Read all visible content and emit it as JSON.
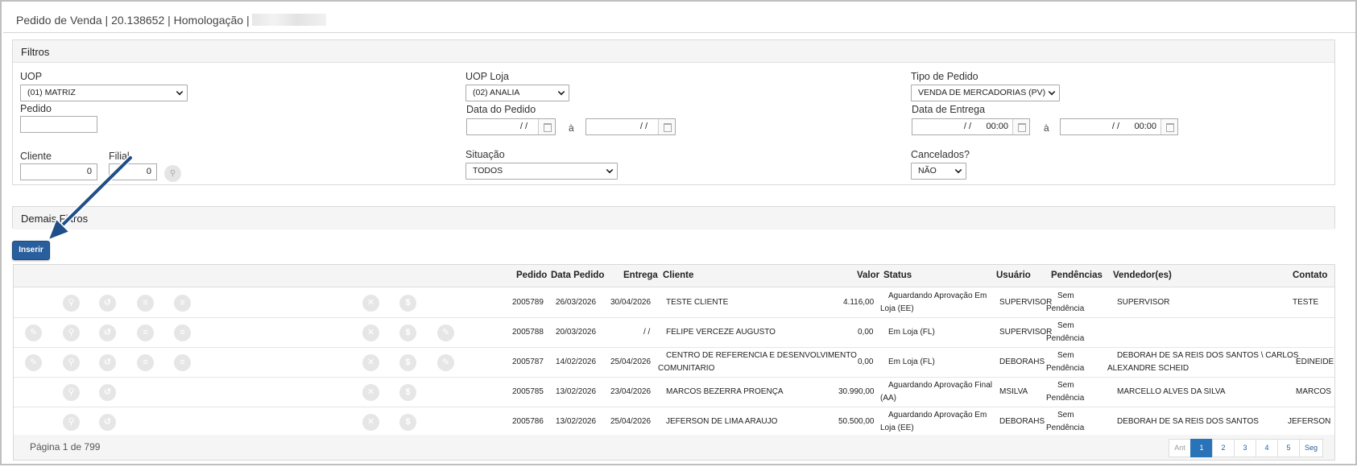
{
  "header": {
    "title": "Pedido de Venda | 20.138652 | Homologação | ",
    "masked_suffix": "_"
  },
  "filters": {
    "heading": "Filtros",
    "uop": {
      "label": "UOP",
      "value": "(01) MATRIZ"
    },
    "uop_loja": {
      "label": "UOP Loja",
      "value": "(02) ANALIA"
    },
    "tipo_pedido": {
      "label": "Tipo de Pedido",
      "value": "VENDA DE MERCADORIAS (PV)"
    },
    "pedido": {
      "label": "Pedido",
      "value": ""
    },
    "data_pedido": {
      "label": "Data do Pedido",
      "from": "/ /",
      "to": "/ /",
      "sep": "à"
    },
    "data_entrega": {
      "label": "Data de Entrega",
      "from": "/ /",
      "from_time": "00:00",
      "to": "/ /",
      "to_time": "00:00",
      "sep": "à"
    },
    "cliente": {
      "label": "Cliente",
      "value": "0"
    },
    "filial": {
      "label": "Filial",
      "value": "0"
    },
    "situacao": {
      "label": "Situação",
      "value": "TODOS"
    },
    "cancelados": {
      "label": "Cancelados?",
      "value": "NÃO"
    }
  },
  "demais_filtros": {
    "heading": "Demais Filtros"
  },
  "actions": {
    "inserir_label": "Inserir"
  },
  "table": {
    "columns": {
      "pedido": "Pedido",
      "data": "Data Pedido",
      "entrega": "Entrega",
      "cliente": "Cliente",
      "valor": "Valor",
      "status": "Status",
      "usuario": "Usuário",
      "pendencias": "Pendências",
      "vendedor": "Vendedor(es)",
      "contato": "Contato"
    },
    "rows": [
      {
        "pedido": "2005789",
        "data": "26/03/2026",
        "entrega": "30/04/2026",
        "cliente1": "TESTE CLIENTE",
        "cliente2": "",
        "valor": "4.116,00",
        "status1": "Aguardando Aprovação Em",
        "status2": "Loja (EE)",
        "usuario": "SUPERVISOR",
        "pend1": "Sem",
        "pend2": "Pendência",
        "vend1": "SUPERVISOR",
        "vend2": "",
        "contato": "TESTE"
      },
      {
        "pedido": "2005788",
        "data": "20/03/2026",
        "entrega": "/ /",
        "cliente1": "FELIPE VERCEZE AUGUSTO",
        "cliente2": "",
        "valor": "0,00",
        "status1": "Em Loja (FL)",
        "status2": "",
        "usuario": "SUPERVISOR",
        "pend1": "Sem",
        "pend2": "Pendência",
        "vend1": "",
        "vend2": "",
        "contato": ""
      },
      {
        "pedido": "2005787",
        "data": "14/02/2026",
        "entrega": "25/04/2026",
        "cliente1": "CENTRO DE REFERENCIA E DESENVOLVIMENTO",
        "cliente2": "COMUNITARIO",
        "valor": "0,00",
        "status1": "Em Loja (FL)",
        "status2": "",
        "usuario": "DEBORAHS",
        "pend1": "Sem",
        "pend2": "Pendência",
        "vend1": "DEBORAH DE SA REIS DOS SANTOS \\ CARLOS",
        "vend2": "ALEXANDRE SCHEID",
        "contato": "EDINEIDE"
      },
      {
        "pedido": "2005785",
        "data": "13/02/2026",
        "entrega": "23/04/2026",
        "cliente1": "MARCOS BEZERRA PROENÇA",
        "cliente2": "",
        "valor": "30.990,00",
        "status1": "Aguardando Aprovação Final",
        "status2": "(AA)",
        "usuario": "MSILVA",
        "pend1": "Sem",
        "pend2": "Pendência",
        "vend1": "MARCELLO ALVES DA SILVA",
        "vend2": "",
        "contato": "MARCOS"
      },
      {
        "pedido": "2005786",
        "data": "13/02/2026",
        "entrega": "25/04/2026",
        "cliente1": "JEFERSON DE LIMA ARAUJO",
        "cliente2": "",
        "valor": "50.500,00",
        "status1": "Aguardando Aprovação Em",
        "status2": "Loja (EE)",
        "usuario": "DEBORAHS",
        "pend1": "Sem",
        "pend2": "Pendência",
        "vend1": "DEBORAH DE SA REIS DOS SANTOS",
        "vend2": "",
        "contato": "JEFERSON"
      }
    ]
  },
  "pagination": {
    "info": "Página 1 de 799",
    "prev": "Ant",
    "next": "Seg",
    "pages": [
      "1",
      "2",
      "3",
      "4",
      "5"
    ]
  },
  "colors": {
    "accent": "#2a5f9e",
    "active_page": "#2a73b8",
    "arrow": "#1f4f8a"
  },
  "icons": {
    "row_actions": [
      "edit-icon",
      "search-icon",
      "history-icon",
      "list-icon",
      "menu-icon",
      "cancel-icon",
      "dollar-icon",
      "edit-note-icon"
    ]
  }
}
